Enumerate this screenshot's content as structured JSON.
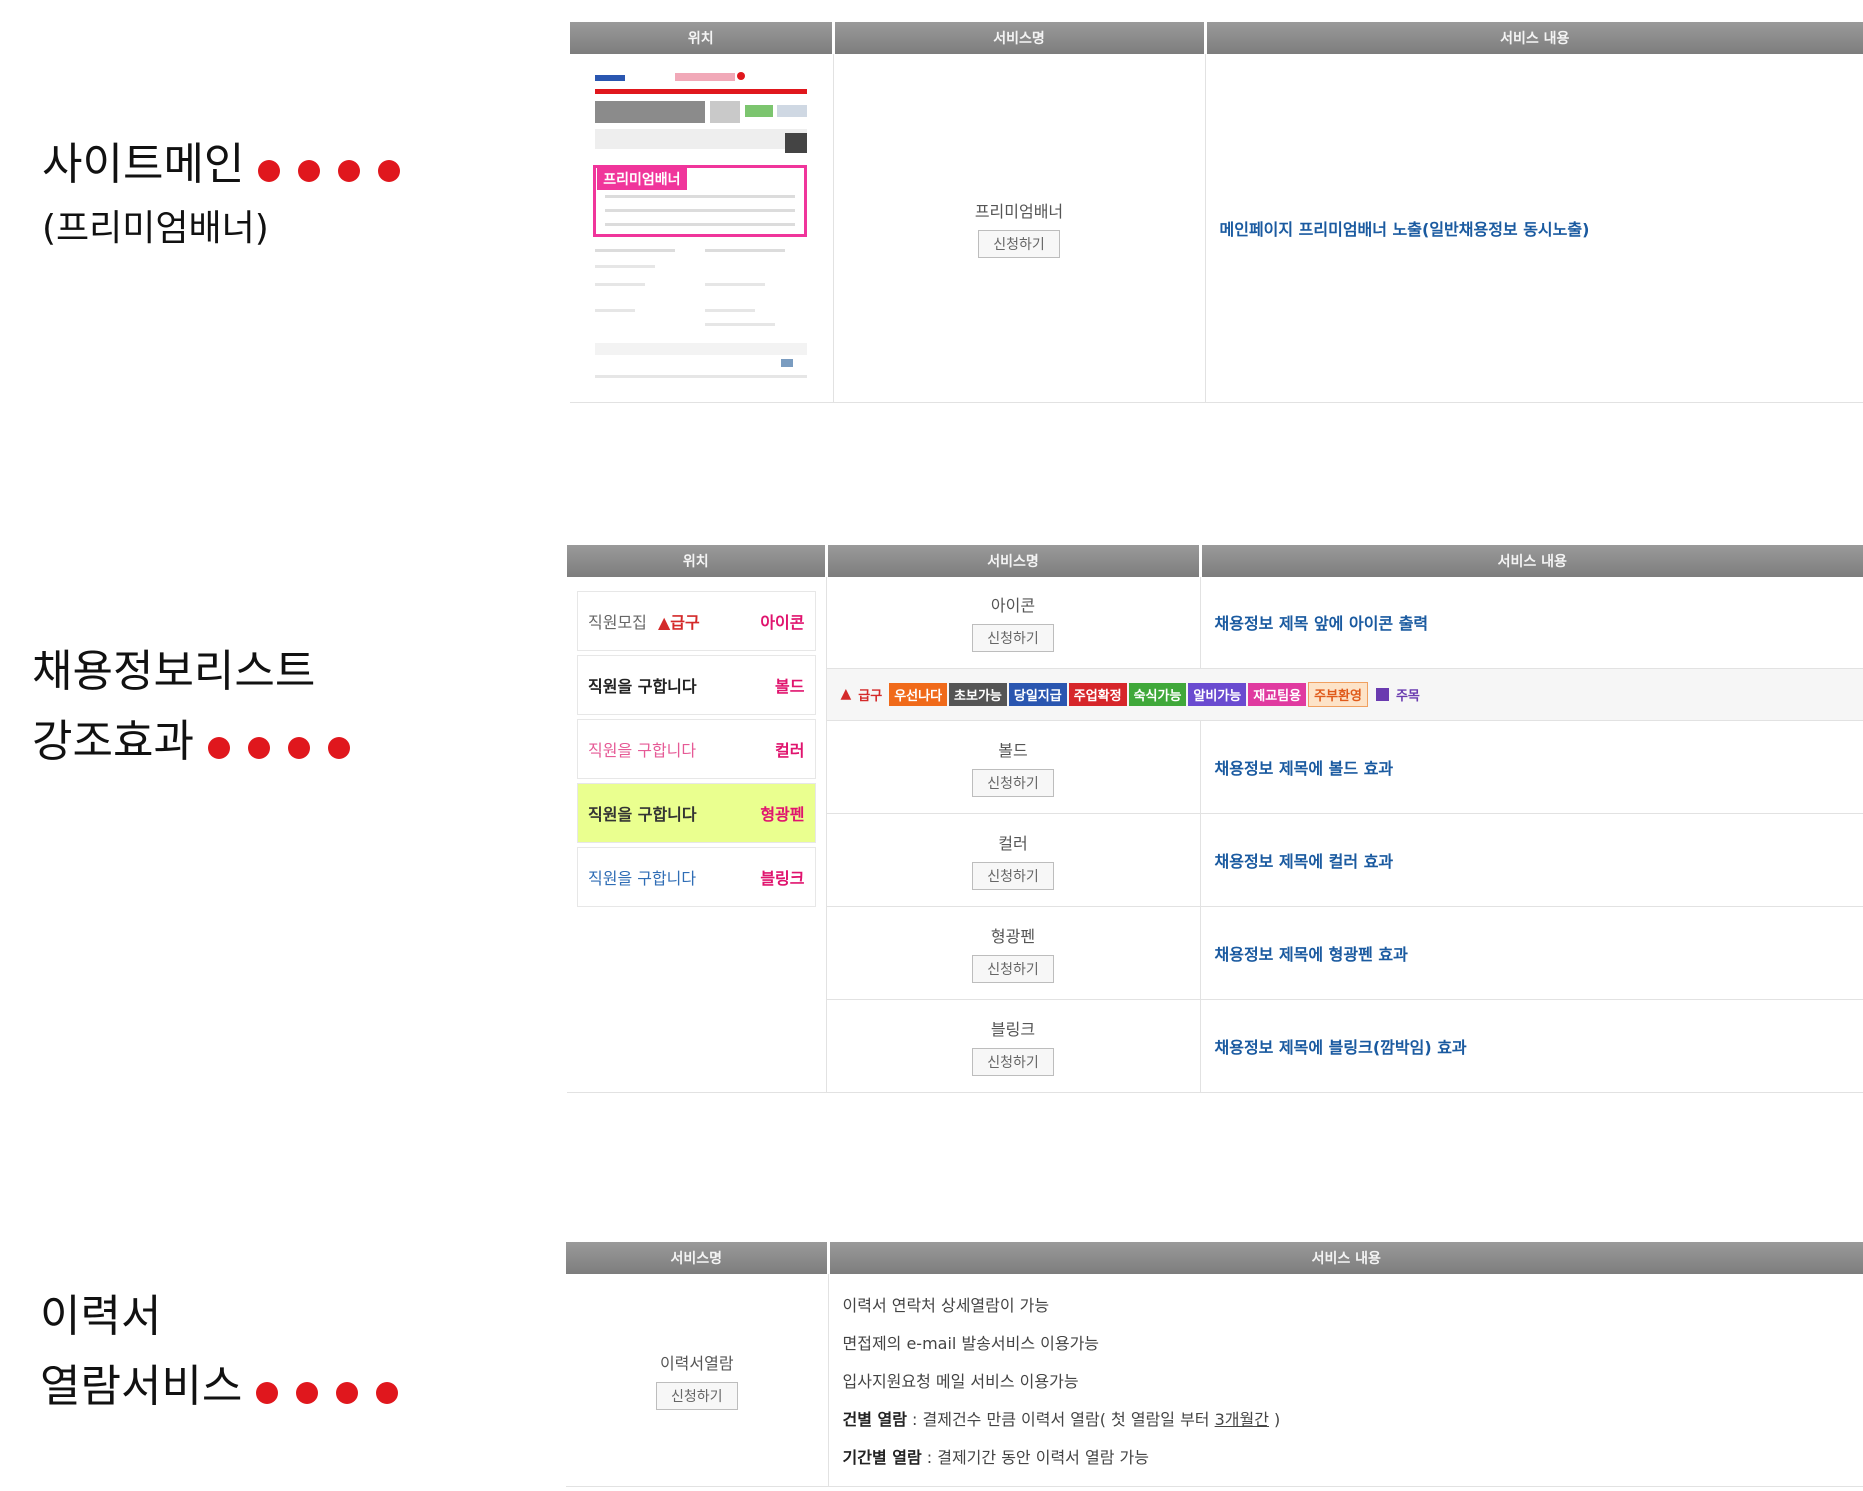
{
  "sections": [
    {
      "line1": "사이트메인",
      "line2": "(프리미엄배너)"
    },
    {
      "line1": "채용정보리스트",
      "line2": "강조효과"
    },
    {
      "line1": "이력서",
      "line2": "열람서비스"
    }
  ],
  "colors": {
    "dot": "#e0171d",
    "header": "#8a8a8a",
    "desc_blue": "#1a5aa0"
  },
  "table1": {
    "headers": [
      "위치",
      "서비스명",
      "서비스 내용"
    ],
    "thumb_banner": "프리미엄배너",
    "service": "프리미엄배너",
    "apply": "신청하기",
    "desc": "메인페이지 프리미엄배너 노출(일반채용정보 동시노출)"
  },
  "table2": {
    "headers": [
      "위치",
      "서비스명",
      "서비스 내용"
    ],
    "examples": [
      {
        "text": "직원모집",
        "urgent": "급구",
        "tag": "아이콘",
        "tag_color": "#e0146e"
      },
      {
        "text": "직원을 구합니다",
        "tag": "볼드",
        "tag_color": "#e0146e"
      },
      {
        "text": "직원을 구합니다",
        "tag": "컬러",
        "tag_color": "#e0146e"
      },
      {
        "text": "직원을 구합니다",
        "tag": "형광펜",
        "tag_color": "#e0146e"
      },
      {
        "text": "직원을 구합니다",
        "tag": "블링크",
        "tag_color": "#e0146e"
      }
    ],
    "badges": [
      {
        "label": "급구",
        "color": "#d42a2a",
        "bg": "transparent"
      },
      {
        "label": "우선나다",
        "color": "#ffffff",
        "bg": "#f06a1a"
      },
      {
        "label": "초보가능",
        "color": "#ffffff",
        "bg": "#555555"
      },
      {
        "label": "당일지급",
        "color": "#ffffff",
        "bg": "#2a56b0"
      },
      {
        "label": "주업확정",
        "color": "#ffffff",
        "bg": "#d6262a"
      },
      {
        "label": "숙식가능",
        "color": "#ffffff",
        "bg": "#40a83a"
      },
      {
        "label": "알비가능",
        "color": "#ffffff",
        "bg": "#6a4bd0"
      },
      {
        "label": "재교팀용",
        "color": "#ffffff",
        "bg": "#e03aa0"
      },
      {
        "label": "주부환영",
        "color": "#e05a1a",
        "bg": "#fde3c8"
      },
      {
        "label": "주목",
        "color": "#6a3bb0",
        "bg": "transparent"
      }
    ],
    "rows": [
      {
        "name": "아이콘",
        "apply": "신청하기",
        "desc": "채용정보 제목 앞에 아이콘 출력"
      },
      {
        "name": "볼드",
        "apply": "신청하기",
        "desc": "채용정보 제목에 볼드 효과"
      },
      {
        "name": "컬러",
        "apply": "신청하기",
        "desc": "채용정보 제목에 컬러 효과"
      },
      {
        "name": "형광펜",
        "apply": "신청하기",
        "desc": "채용정보 제목에 형광펜 효과"
      },
      {
        "name": "블링크",
        "apply": "신청하기",
        "desc": "채용정보 제목에 블링크(깜박임) 효과"
      }
    ]
  },
  "table3": {
    "headers": [
      "서비스명",
      "서비스 내용"
    ],
    "service": "이력서열람",
    "apply": "신청하기",
    "lines": [
      "이력서 연락처 상세열람이 가능",
      "면접제의 e-mail 발송서비스 이용가능",
      "입사지원요청 메일 서비스 이용가능"
    ],
    "case_label": "건별 열람",
    "case_text": " : 결제건수 만큼 이력서 열람( 첫 열람일 부터 ",
    "case_period": "3개월간",
    "case_end": " )",
    "period_label": "기간별 열람",
    "period_text": " : 결제기간 동안 이력서 열람 가능"
  }
}
